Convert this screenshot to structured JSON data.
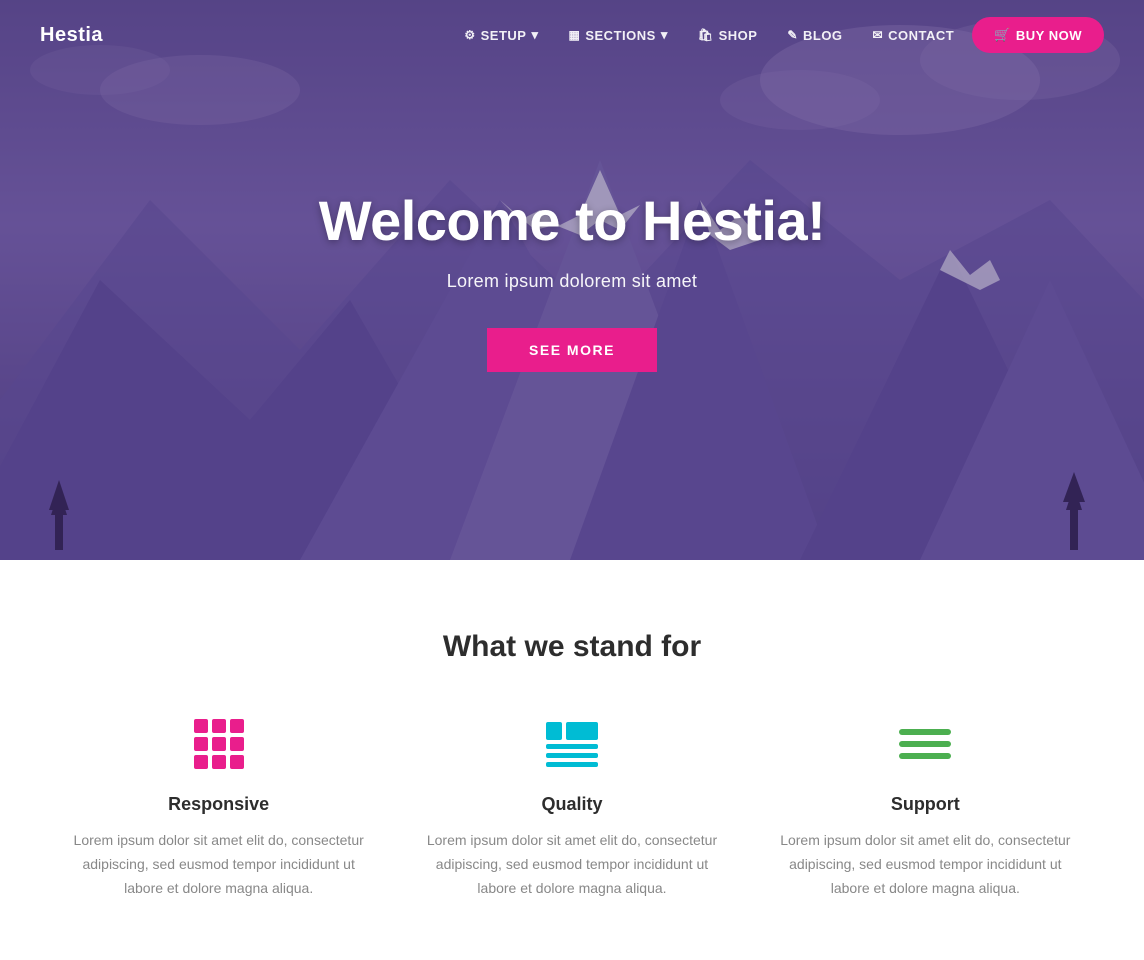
{
  "brand": "Hestia",
  "nav": {
    "items": [
      {
        "id": "setup",
        "label": "SETUP",
        "icon": "⚙",
        "hasDropdown": true
      },
      {
        "id": "sections",
        "label": "SECTIONS",
        "icon": "▦",
        "hasDropdown": true
      },
      {
        "id": "shop",
        "label": "SHOP",
        "icon": "🛍",
        "hasDropdown": false
      },
      {
        "id": "blog",
        "label": "BLOG",
        "icon": "✎",
        "hasDropdown": false
      },
      {
        "id": "contact",
        "label": "CONTACT",
        "icon": "✉",
        "hasDropdown": false
      }
    ],
    "cta": {
      "label": "BUY NOW",
      "icon": "🛒"
    }
  },
  "hero": {
    "title": "Welcome to Hestia!",
    "subtitle": "Lorem ipsum dolorem sit amet",
    "cta_label": "SEE MORE"
  },
  "features": {
    "section_title": "What we stand for",
    "items": [
      {
        "id": "responsive",
        "name": "Responsive",
        "icon_type": "grid",
        "description": "Lorem ipsum dolor sit amet elit do, consectetur adipiscing, sed eusmod tempor incididunt ut labore et dolore magna aliqua."
      },
      {
        "id": "quality",
        "name": "Quality",
        "icon_type": "table",
        "description": "Lorem ipsum dolor sit amet elit do, consectetur adipiscing, sed eusmod tempor incididunt ut labore et dolore magna aliqua."
      },
      {
        "id": "support",
        "name": "Support",
        "icon_type": "lines",
        "description": "Lorem ipsum dolor sit amet elit do, consectetur adipiscing, sed eusmod tempor incididunt ut labore et dolore magna aliqua."
      }
    ]
  },
  "colors": {
    "brand_pink": "#e91e8c",
    "cyan": "#00bcd4",
    "green": "#4caf50",
    "dark_text": "#2d2d2d",
    "gray_text": "#888888"
  }
}
